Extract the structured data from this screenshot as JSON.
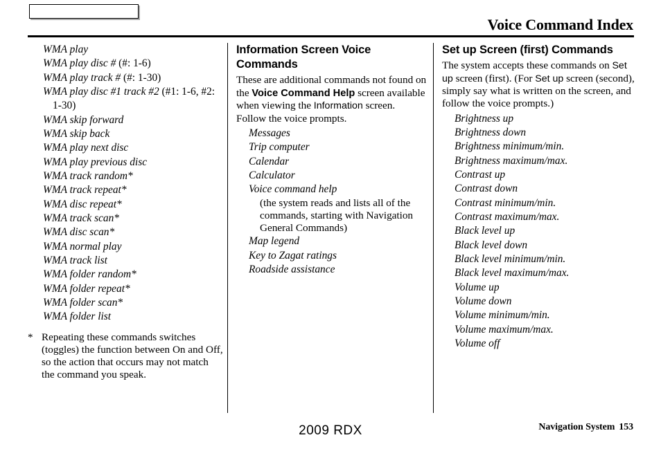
{
  "header": {
    "box_label": "",
    "title": "Voice Command Index"
  },
  "column1": {
    "items": [
      {
        "text": "WMA play"
      },
      {
        "text": "WMA play disc # ",
        "roman": "(#: 1-6)"
      },
      {
        "text": "WMA play track # ",
        "roman": "(#: 1-30)"
      },
      {
        "text": "WMA play disc #1 track #2 ",
        "roman": "(#1: 1-6, #2: 1-30)",
        "wrap": true
      },
      {
        "text": "WMA skip forward"
      },
      {
        "text": "WMA skip back"
      },
      {
        "text": "WMA play next disc"
      },
      {
        "text": "WMA play previous disc"
      },
      {
        "text": "WMA track random*"
      },
      {
        "text": "WMA track repeat*"
      },
      {
        "text": "WMA disc repeat*"
      },
      {
        "text": "WMA track scan*"
      },
      {
        "text": "WMA disc scan*"
      },
      {
        "text": "WMA normal play"
      },
      {
        "text": "WMA track list"
      },
      {
        "text": "WMA folder random*"
      },
      {
        "text": "WMA folder repeat*"
      },
      {
        "text": "WMA folder scan*"
      },
      {
        "text": "WMA folder list"
      }
    ],
    "footnote_marker": "*",
    "footnote_text": "Repeating these commands switches (toggles) the function between On and Off, so the action that occurs may not match the command you speak."
  },
  "column2": {
    "heading": "Information Screen Voice Commands",
    "intro_part1": "These are additional commands not found on the ",
    "intro_bold": "Voice Command Help",
    "intro_part2": " screen available when viewing the ",
    "intro_sans": "Information",
    "intro_part3": " screen. Follow the voice prompts.",
    "items": [
      {
        "text": "Messages"
      },
      {
        "text": "Trip computer"
      },
      {
        "text": "Calendar"
      },
      {
        "text": "Calculator"
      },
      {
        "text": "Voice command help",
        "note": "(the system reads and lists all of the commands, starting with Navigation General Commands)"
      },
      {
        "text": "Map legend"
      },
      {
        "text": "Key to Zagat ratings"
      },
      {
        "text": "Roadside assistance"
      }
    ]
  },
  "column3": {
    "heading": "Set up Screen (first) Commands",
    "intro_part1": "The system accepts these commands on ",
    "intro_sans1": "Set up",
    "intro_part2": " screen (first). (For ",
    "intro_sans2": "Set up",
    "intro_part3": " screen (second), simply say what is written on the screen, and follow the voice prompts.)",
    "items": [
      {
        "text": "Brightness up"
      },
      {
        "text": "Brightness down"
      },
      {
        "text": "Brightness minimum/min."
      },
      {
        "text": "Brightness maximum/max."
      },
      {
        "text": "Contrast up"
      },
      {
        "text": "Contrast down"
      },
      {
        "text": "Contrast minimum/min."
      },
      {
        "text": "Contrast maximum/max."
      },
      {
        "text": "Black level up"
      },
      {
        "text": "Black level down"
      },
      {
        "text": "Black level minimum/min."
      },
      {
        "text": "Black level maximum/max."
      },
      {
        "text": "Volume up"
      },
      {
        "text": "Volume down"
      },
      {
        "text": "Volume minimum/min."
      },
      {
        "text": "Volume maximum/max."
      },
      {
        "text": "Volume off"
      }
    ]
  },
  "footer": {
    "model": "2009  RDX",
    "section": "Navigation System",
    "page_number": "153"
  }
}
